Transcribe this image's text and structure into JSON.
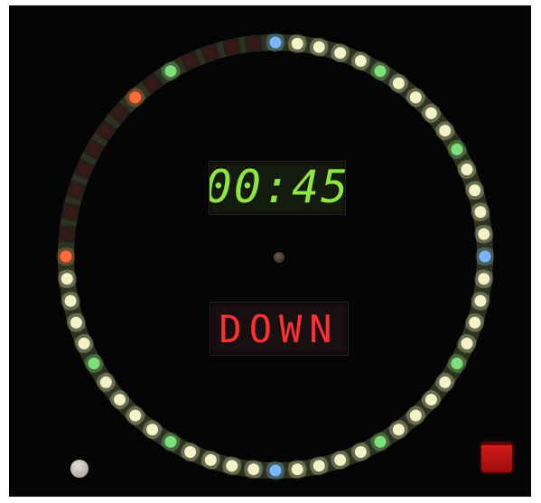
{
  "time_display": {
    "value": "00:45",
    "color": "#8fe640",
    "dim_color": "#2a3a1a"
  },
  "word_display": {
    "value": "DOWN",
    "color": "#ff3030",
    "dim_color": "#3a1515"
  },
  "led_ring": {
    "count": 60,
    "colors": {
      "lit": "#f4f2c8",
      "tick": "#7de07a",
      "marker": "#79b6ff",
      "off": "#3a1a16",
      "red": "#ff6a3a"
    },
    "states": [
      "marker",
      "lit",
      "lit",
      "lit",
      "lit",
      "tick",
      "lit",
      "lit",
      "lit",
      "lit",
      "tick",
      "lit",
      "lit",
      "lit",
      "lit",
      "blue",
      "lit",
      "lit",
      "lit",
      "lit",
      "tick",
      "lit",
      "lit",
      "lit",
      "lit",
      "tick",
      "lit",
      "lit",
      "lit",
      "lit",
      "blue",
      "lit",
      "lit",
      "lit",
      "lit",
      "tick",
      "lit",
      "lit",
      "lit",
      "lit",
      "tick",
      "lit",
      "lit",
      "lit",
      "lit",
      "red",
      "off",
      "off",
      "off",
      "off",
      "off",
      "off",
      "off",
      "red",
      "off",
      "tick",
      "off",
      "off",
      "off",
      "off"
    ]
  },
  "controls": {
    "mode_button": "button",
    "power_button": "button"
  }
}
